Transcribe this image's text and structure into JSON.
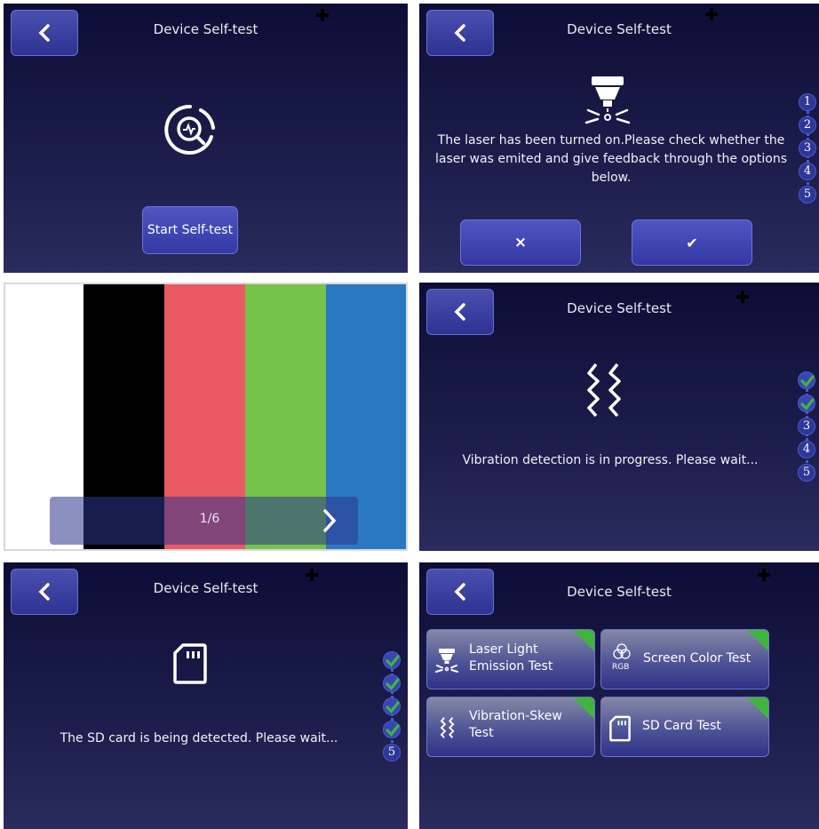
{
  "screens": {
    "intro": {
      "title": "Device Self-test",
      "start_label": "Start Self-test"
    },
    "laser": {
      "title": "Device Self-test",
      "message": "The laser has been turned on.Please check whether the laser was emited and give feedback through the options below.",
      "fail_label": "×",
      "pass_label": "✔",
      "steps": [
        "1",
        "2",
        "3",
        "4",
        "5"
      ]
    },
    "color": {
      "page_indicator": "1/6",
      "next_label": "❯",
      "bars": [
        "#ffffff",
        "#000000",
        "#e95a63",
        "#74c34b",
        "#2a78c2"
      ]
    },
    "vibration": {
      "title": "Device Self-test",
      "message": "Vibration detection is in progress. Please wait...",
      "steps": [
        "✔",
        "✔",
        "3",
        "4",
        "5"
      ]
    },
    "sdcard": {
      "title": "Device Self-test",
      "message": "The SD card is being detected. Please wait...",
      "steps": [
        "✔",
        "✔",
        "✔",
        "✔",
        "5"
      ]
    },
    "results": {
      "title": "Device Self-test",
      "tiles": [
        {
          "label": "Laser Light Emission Test",
          "icon": "laser-icon",
          "passed": true
        },
        {
          "label": "Screen Color Test",
          "icon": "rgb-icon",
          "icon_text": "RGB",
          "passed": true
        },
        {
          "label": "Vibration-Skew Test",
          "icon": "vibration-icon",
          "passed": true
        },
        {
          "label": "SD Card Test",
          "icon": "sd-card-icon",
          "passed": true
        }
      ]
    }
  },
  "colors": {
    "check_green": "#3fb53f",
    "button_blue": "#3f44b0",
    "panel_dark": "#14153f"
  }
}
